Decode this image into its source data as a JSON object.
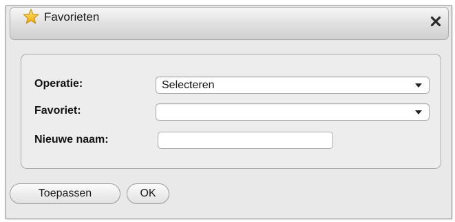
{
  "dialog": {
    "title": "Favorieten",
    "title_icon": "star-icon",
    "close_icon": "close-icon"
  },
  "form": {
    "operation": {
      "label": "Operatie:",
      "value": "Selecteren"
    },
    "favorite": {
      "label": "Favoriet:",
      "value": ""
    },
    "new_name": {
      "label": "Nieuwe naam:",
      "value": ""
    }
  },
  "buttons": {
    "apply_label": "Toepassen",
    "ok_label": "OK"
  },
  "colors": {
    "star": "#f5c21a",
    "dialog_background": "#e9e9e9"
  }
}
